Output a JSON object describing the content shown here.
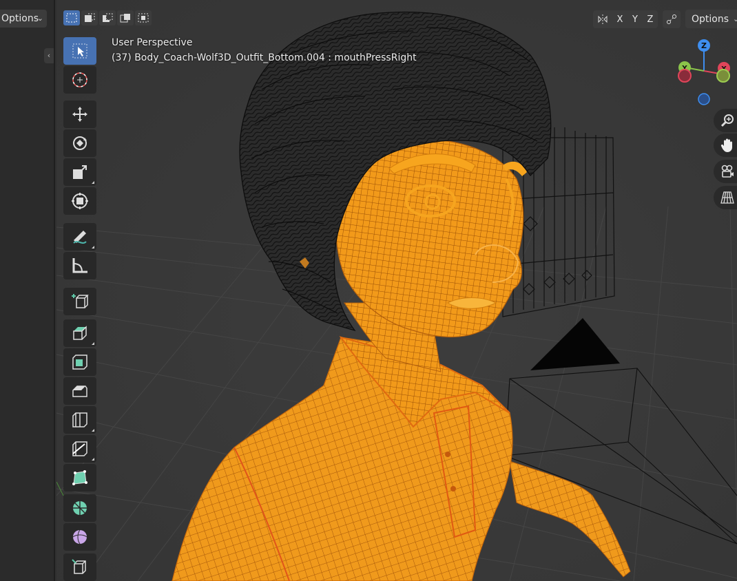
{
  "side_panel": {
    "options_label": "Options"
  },
  "viewport": {
    "view_name": "User Perspective",
    "object_info": "(37) Body_Coach-Wolf3D_Outfit_Bottom.004 : mouthPressRight"
  },
  "header": {
    "axis_x": "X",
    "axis_y": "Y",
    "axis_z": "Z",
    "options_label": "Options"
  },
  "gizmo": {
    "z_label": "Z",
    "y_label": "Y",
    "x_label": "X"
  },
  "colors": {
    "selection_orange": "#f5a623",
    "active_blue": "#4772b3",
    "axis_x": "#e0455a",
    "axis_y": "#8bc34a",
    "axis_z": "#3e8ef0"
  }
}
